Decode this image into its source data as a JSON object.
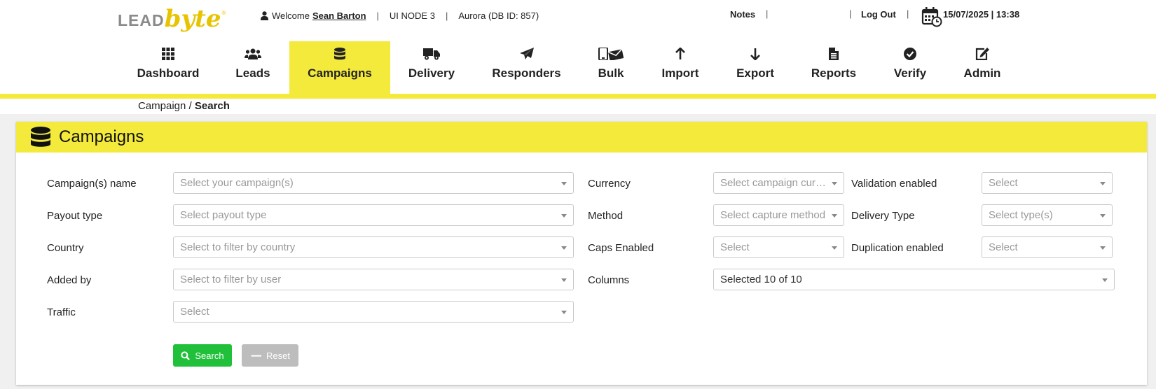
{
  "header": {
    "logo_lead": "LEAD",
    "logo_byte": "byte",
    "logo_reg": "®",
    "welcome": "Welcome",
    "user_name": "Sean Barton",
    "node": "UI NODE 3",
    "db": "Aurora (DB ID: 857)",
    "notes": "Notes",
    "logout": "Log Out",
    "datetime": "15/07/2025 | 13:38",
    "separator": "|"
  },
  "nav": {
    "items": [
      {
        "label": "Dashboard",
        "icon": "grid-icon"
      },
      {
        "label": "Leads",
        "icon": "users-icon"
      },
      {
        "label": "Campaigns",
        "icon": "database-icon",
        "active": true
      },
      {
        "label": "Delivery",
        "icon": "truck-icon"
      },
      {
        "label": "Responders",
        "icon": "paper-plane-icon"
      },
      {
        "label": "Bulk",
        "icon": "mobile-envelope-icon"
      },
      {
        "label": "Import",
        "icon": "arrow-up-icon"
      },
      {
        "label": "Export",
        "icon": "arrow-down-icon"
      },
      {
        "label": "Reports",
        "icon": "file-icon"
      },
      {
        "label": "Verify",
        "icon": "check-circle-icon"
      },
      {
        "label": "Admin",
        "icon": "edit-icon"
      }
    ]
  },
  "breadcrumb": {
    "parent": "Campaign",
    "separator": " / ",
    "current": "Search"
  },
  "panel": {
    "title": "Campaigns"
  },
  "form": {
    "campaign_name": {
      "label": "Campaign(s) name",
      "placeholder": "Select your campaign(s)"
    },
    "payout_type": {
      "label": "Payout type",
      "placeholder": "Select payout type"
    },
    "country": {
      "label": "Country",
      "placeholder": "Select to filter by country"
    },
    "added_by": {
      "label": "Added by",
      "placeholder": "Select to filter by user"
    },
    "traffic": {
      "label": "Traffic",
      "placeholder": "Select"
    },
    "currency": {
      "label": "Currency",
      "placeholder": "Select campaign currency"
    },
    "method": {
      "label": "Method",
      "placeholder": "Select capture method"
    },
    "caps_enabled": {
      "label": "Caps Enabled",
      "placeholder": "Select"
    },
    "columns": {
      "label": "Columns",
      "value": "Selected 10 of 10"
    },
    "validation_enabled": {
      "label": "Validation enabled",
      "placeholder": "Select"
    },
    "delivery_type": {
      "label": "Delivery Type",
      "placeholder": "Select type(s)"
    },
    "duplication_enabled": {
      "label": "Duplication enabled",
      "placeholder": "Select"
    }
  },
  "buttons": {
    "search": "Search",
    "reset": "Reset"
  },
  "colors": {
    "accent_yellow": "#f4ea3b",
    "logo_yellow": "#e8c400",
    "search_green": "#21c03a",
    "reset_grey": "#bdbdbd"
  }
}
